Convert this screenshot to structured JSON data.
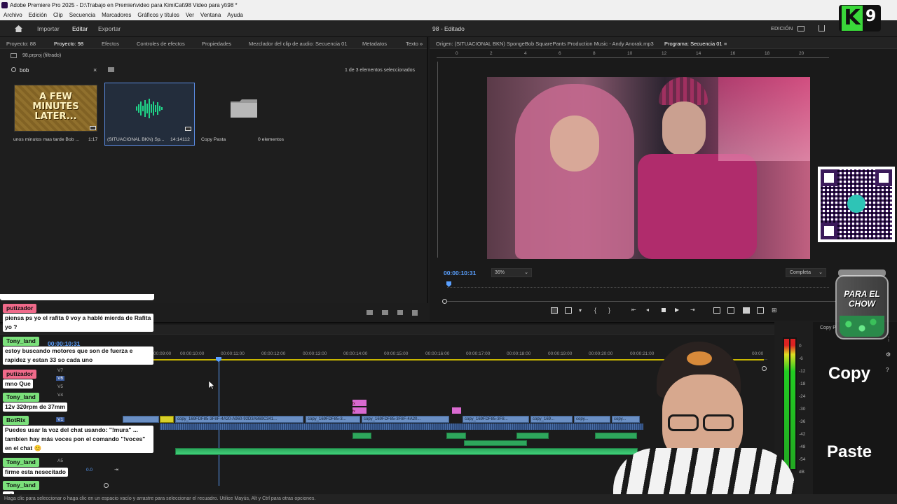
{
  "window": {
    "title": "Adobe Premiere Pro 2025 - D:\\Trabajo en Premier\\video para KimiCat\\98 Video para yt\\98 *"
  },
  "menu": [
    "Archivo",
    "Edición",
    "Clip",
    "Secuencia",
    "Marcadores",
    "Gráficos y títulos",
    "Ver",
    "Ventana",
    "Ayuda"
  ],
  "workspace": {
    "tabs": [
      "Importar",
      "Editar",
      "Exportar"
    ],
    "active_tab": "Editar",
    "doc_title": "98 - Editado",
    "mode": "EDICIÓN"
  },
  "project_panel": {
    "tabs": [
      "Proyecto: 88",
      "Proyecto: 98",
      "Efectos",
      "Controles de efectos",
      "Propiedades",
      "Mezclador del clip de audio: Secuencia 01",
      "Metadatos",
      "Texto"
    ],
    "active_tab": "Proyecto: 98",
    "path": "98.prproj (filtrado)",
    "search_value": "bob",
    "selection_status": "1 de 3 elementos seleccionados",
    "items": [
      {
        "thumb_text": "A FEW MINUTES LATER...",
        "name": "unos minutos mas tarde Bob ...",
        "duration": "1:17"
      },
      {
        "name": "(SITUACIONAL BKN) Sp...",
        "duration": "14:14112"
      },
      {
        "name": "Copy Pasta",
        "duration": "0 elementos"
      }
    ]
  },
  "program_panel": {
    "source_label": "Origen: (SITUACIONAL BKN) SpongeBob SquarePants Production Music - Andy Anorak.mp3",
    "program_label": "Programa: Secuencia 01",
    "timecode": "00:00:10:31",
    "zoom": "36%",
    "quality": "Completa",
    "ruler_marks": [
      "0",
      "2",
      "4",
      "6",
      "8",
      "10",
      "12",
      "14",
      "16",
      "18",
      "20"
    ]
  },
  "timeline": {
    "timecode": "00:00:10:31",
    "ruler": [
      "00:09:00",
      "00:00:10:00",
      "00:00:11:00",
      "00:00:12:00",
      "00:00:13:00",
      "00:00:14:00",
      "00:00:15:00",
      "00:00:16:00",
      "00:00:17:00",
      "00:00:18:00",
      "00:00:19:00",
      "00:00:20:00",
      "00:00:21:00",
      "00:00"
    ],
    "tracks": [
      "V7",
      "V6",
      "V5",
      "V4",
      "V3",
      "V2",
      "V1",
      "A1",
      "A2",
      "A3",
      "A4",
      "A5"
    ],
    "clip_labels": [
      "fx",
      "fx",
      "copy_169FDF85-3F8F-4A20-A960-92D3A869C341...",
      "fx",
      "copy_169FDF85-3...",
      "fx",
      "copy_169FDF85-3F8F-4A20...",
      "fx",
      "copy_169FDF85-3F8...",
      "copy_169...",
      "copy...",
      "copy..."
    ],
    "master_value": "0.0",
    "vu_scale": [
      "0",
      "-6",
      "-12",
      "-18",
      "-24",
      "-30",
      "-36",
      "-42",
      "-48",
      "-54",
      "dB"
    ]
  },
  "status": {
    "hint": "Haga clic para seleccionar o haga clic en un espacio vacío y arrastre para seleccionar el recuadro. Utilice Mayús, Alt y Ctrl para otras opciones."
  },
  "chat": [
    {
      "user": "putizador",
      "color": "#f06a8a",
      "msg": "piensa ps yo el rafita 0 voy a hablé mierda de Rafita yo ?"
    },
    {
      "user": "Tony_land",
      "color": "#7be07b",
      "msg": "estoy buscando motores que son de fuerza e rapidez y estan 33 so cada uno"
    },
    {
      "user": "putizador",
      "color": "#f06a8a",
      "msg": "mno Que"
    },
    {
      "user": "Tony_land",
      "color": "#7be07b",
      "msg": "12v 320rpm de 37mm"
    },
    {
      "user": "BotRix",
      "color": "#7be07b",
      "msg": "Puedes usar la voz del chat usando: \"!mura\" ... tambien hay más voces pon el comando \"!voces\" en el chat 😊"
    },
    {
      "user": "Tony_land",
      "color": "#7be07b",
      "msg": "firme esta nesecitado"
    },
    {
      "user": "Tony_land",
      "color": "#7be07b",
      "msg": "xd"
    }
  ],
  "overlay": {
    "logo_letter": "K",
    "logo_number": "9",
    "jar_text": "PARA EL CHOW",
    "copy_label": "Copy",
    "paste_label": "Paste",
    "copy_panel_label": "Copy P"
  }
}
